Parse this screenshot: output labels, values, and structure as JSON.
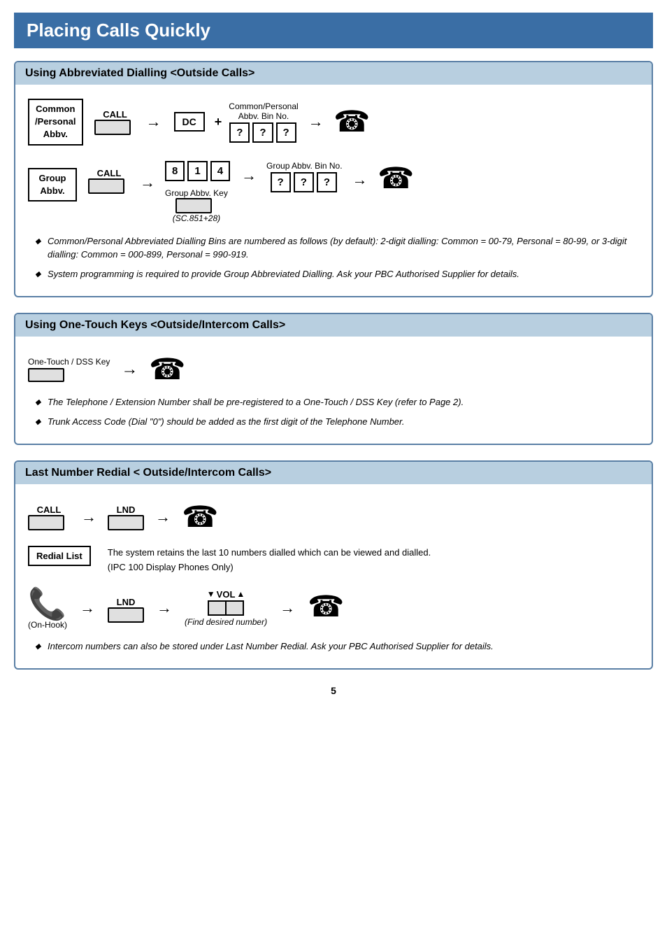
{
  "page": {
    "title": "Placing Calls Quickly",
    "page_number": "5"
  },
  "section1": {
    "header": "Using Abbreviated Dialling <Outside Calls>",
    "row1": {
      "label_line1": "Common",
      "label_line2": "/Personal",
      "label_line3": "Abbv.",
      "call_label": "CALL",
      "dc_label": "DC",
      "abbv_bin_label": "Common/Personal",
      "abbv_bin_label2": "Abbv. Bin No."
    },
    "row2": {
      "label_line1": "Group",
      "label_line2": "Abbv.",
      "call_label": "CALL",
      "digit1": "8",
      "digit2": "1",
      "digit3": "4",
      "group_abbv_bin_label": "Group Abbv. Bin No.",
      "group_abbv_key_label": "Group Abbv. Key",
      "sc_note": "(SC.851+28)"
    },
    "bullets": [
      "Common/Personal Abbreviated Dialling Bins are numbered as follows (by default):\n2-digit dialling: Common = 00-79, Personal = 80-99, or\n3-digit dialling: Common = 000-899, Personal = 990-919.",
      "System programming is required to provide Group Abbreviated Dialling.    Ask your PBC Authorised Supplier for details."
    ]
  },
  "section2": {
    "header": "Using One-Touch Keys <Outside/Intercom Calls>",
    "key_label": "One-Touch / DSS Key",
    "bullets": [
      "The Telephone / Extension Number shall be pre-registered to a One-Touch / DSS Key (refer to Page 2).",
      "Trunk Access Code (Dial \"0\") should be added as the first digit of the Telephone Number."
    ]
  },
  "section3": {
    "header": "Last Number Redial < Outside/Intercom Calls>",
    "call_label": "CALL",
    "lnd_label": "LND",
    "redial_list_label": "Redial List",
    "redial_info_line1": "The system retains the last 10 numbers dialled which can be viewed and dialled.",
    "redial_info_line2": "(IPC 100 Display Phones Only)",
    "lnd_label2": "LND",
    "vol_label": "VOL",
    "find_desired": "(Find desired number)",
    "on_hook_label": "(On-Hook)",
    "bullets": [
      "Intercom numbers can also be stored under Last Number Redial.    Ask your PBC Authorised Supplier for details."
    ]
  },
  "icons": {
    "phone": "☎",
    "arrow_right": "→"
  }
}
